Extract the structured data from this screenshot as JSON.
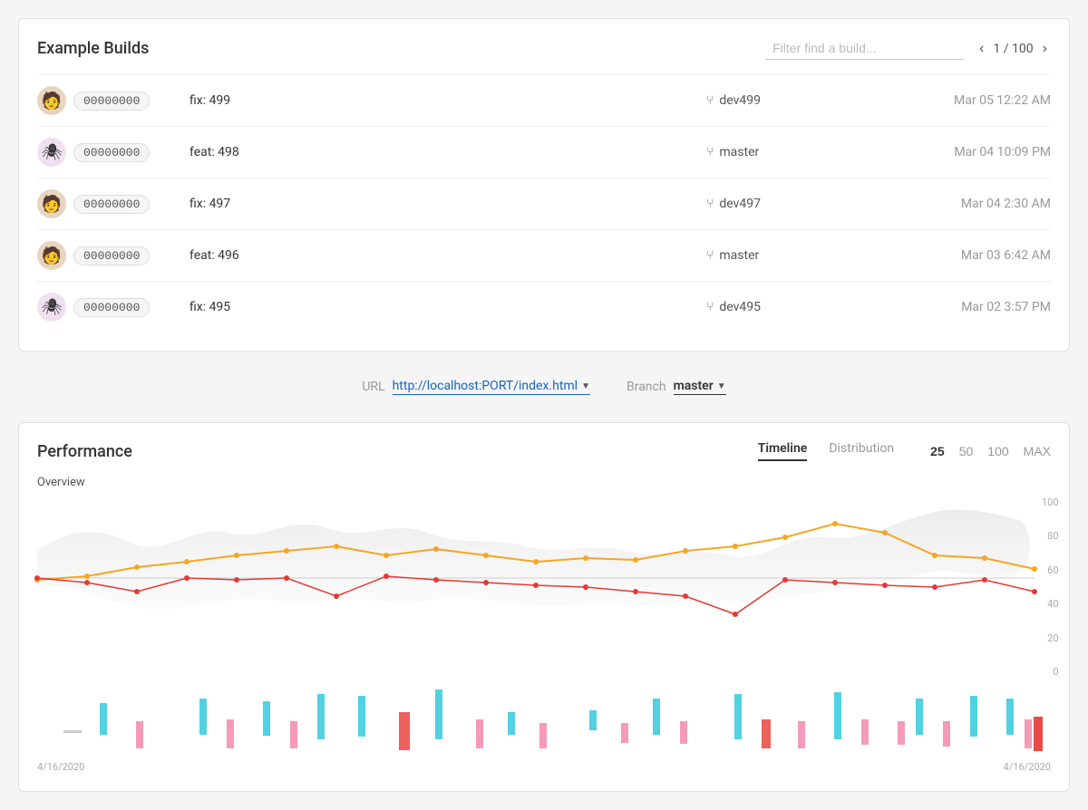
{
  "page": {
    "title": "Example Builds"
  },
  "filter": {
    "placeholder": "Filter find a build..."
  },
  "pagination": {
    "current": 1,
    "total": 100,
    "display": "1 / 100"
  },
  "builds": [
    {
      "id": "00000000",
      "name": "fix: 499",
      "branch": "dev499",
      "date": "Mar 05 12:22 AM",
      "avatarType": "person"
    },
    {
      "id": "00000000",
      "name": "feat: 498",
      "branch": "master",
      "date": "Mar 04 10:09 PM",
      "avatarType": "spider"
    },
    {
      "id": "00000000",
      "name": "fix: 497",
      "branch": "dev497",
      "date": "Mar 04 2:30 AM",
      "avatarType": "person"
    },
    {
      "id": "00000000",
      "name": "feat: 496",
      "branch": "master",
      "date": "Mar 03 6:42 AM",
      "avatarType": "person"
    },
    {
      "id": "00000000",
      "name": "fix: 495",
      "branch": "dev495",
      "date": "Mar 02 3:57 PM",
      "avatarType": "spider"
    }
  ],
  "controls": {
    "url_label": "URL",
    "url_value": "http://localhost:PORT/index.html",
    "branch_label": "Branch",
    "branch_value": "master"
  },
  "performance": {
    "title": "Performance",
    "tabs": [
      "Timeline",
      "Distribution"
    ],
    "active_tab": "Timeline",
    "range_buttons": [
      "25",
      "50",
      "100",
      "MAX"
    ],
    "active_range": "25",
    "chart_label": "Overview",
    "y_axis": [
      "100",
      "80",
      "60",
      "40",
      "20",
      "0"
    ],
    "date_start": "4/16/2020",
    "date_end": "4/16/2020"
  }
}
